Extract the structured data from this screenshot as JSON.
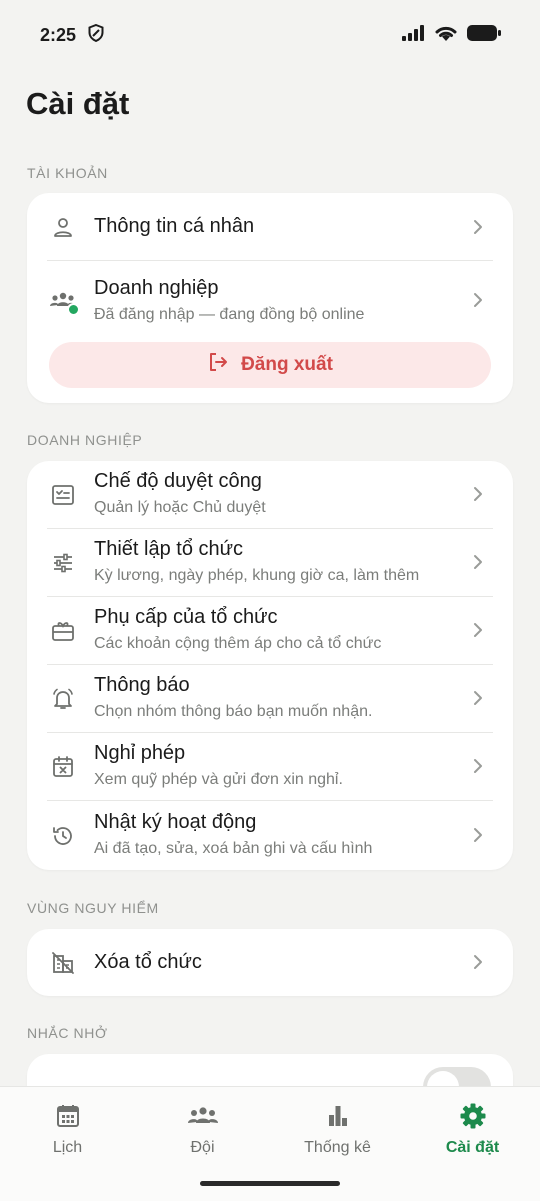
{
  "status_bar": {
    "time": "2:25"
  },
  "page": {
    "title": "Cài đặt"
  },
  "account": {
    "section_label": "TÀI KHOẢN",
    "personal_info": "Thông tin cá nhân",
    "business_title": "Doanh nghiệp",
    "business_sub": "Đã đăng nhập — đang đồng bộ online",
    "logout_label": "Đăng xuất"
  },
  "business": {
    "section_label": "DOANH NGHIỆP",
    "items": [
      {
        "title": "Chế độ duyệt công",
        "sub": "Quản lý hoặc Chủ duyệt",
        "icon": "checklist-icon"
      },
      {
        "title": "Thiết lập tổ chức",
        "sub": "Kỳ lương, ngày phép, khung giờ ca, làm thêm",
        "icon": "sliders-icon"
      },
      {
        "title": "Phụ cấp của tổ chức",
        "sub": "Các khoản cộng thêm áp cho cả tổ chức",
        "icon": "gift-card-icon"
      },
      {
        "title": "Thông báo",
        "sub": "Chọn nhóm thông báo bạn muốn nhận.",
        "icon": "bell-icon"
      },
      {
        "title": "Nghỉ phép",
        "sub": "Xem quỹ phép và gửi đơn xin nghỉ.",
        "icon": "calendar-x-icon"
      },
      {
        "title": "Nhật ký hoạt động",
        "sub": "Ai đã tạo, sửa, xoá bản ghi và cấu hình",
        "icon": "history-icon"
      }
    ]
  },
  "danger": {
    "section_label": "VÙNG NGUY HIỂM",
    "delete_org": "Xóa tổ chức"
  },
  "reminder": {
    "section_label": "NHẮC NHỞ",
    "toggle_on": false
  },
  "bottom_nav": [
    {
      "label": "Lịch",
      "icon": "calendar-icon",
      "active": false
    },
    {
      "label": "Đội",
      "icon": "team-icon",
      "active": false
    },
    {
      "label": "Thống kê",
      "icon": "bar-chart-icon",
      "active": false
    },
    {
      "label": "Cài đặt",
      "icon": "gear-icon",
      "active": true
    }
  ],
  "colors": {
    "accent": "#1d8a4c",
    "danger": "#d24a4a",
    "danger_bg": "#fce8e8",
    "online": "#23a760"
  }
}
